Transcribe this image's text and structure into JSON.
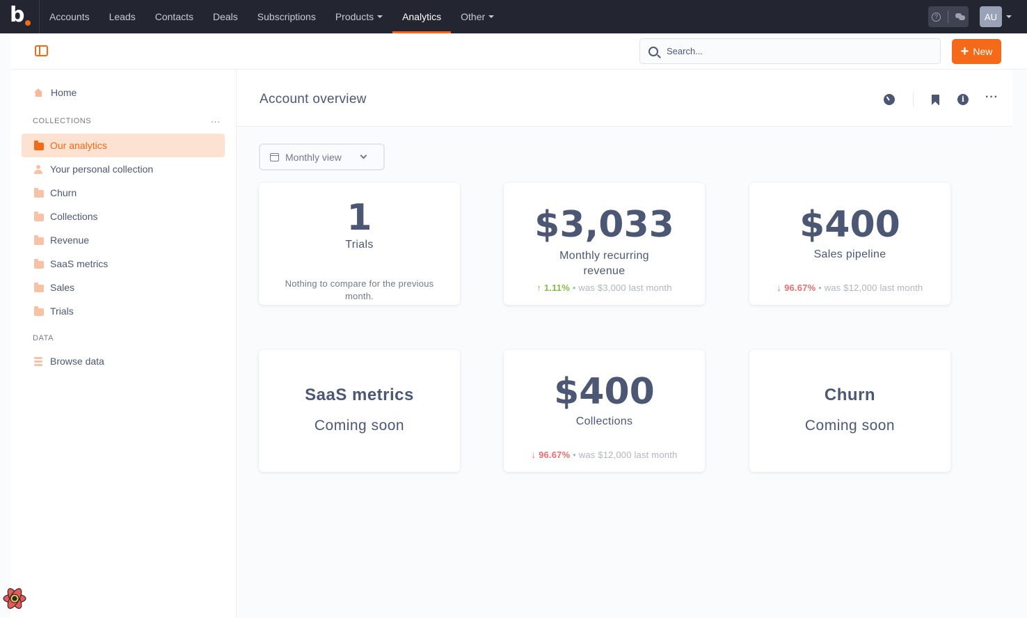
{
  "brand": {
    "logo_letter": "b",
    "accent_color": "#f56a18",
    "nav_bg": "#232530"
  },
  "nav": {
    "items": [
      {
        "label": "Accounts"
      },
      {
        "label": "Leads"
      },
      {
        "label": "Contacts"
      },
      {
        "label": "Deals"
      },
      {
        "label": "Subscriptions"
      },
      {
        "label": "Products",
        "dropdown": true
      },
      {
        "label": "Analytics",
        "active": true
      },
      {
        "label": "Other",
        "dropdown": true
      }
    ],
    "user_initials": "AU"
  },
  "toolbar": {
    "search_placeholder": "Search...",
    "new_label": "New"
  },
  "sidebar": {
    "home_label": "Home",
    "collections_heading": "COLLECTIONS",
    "collections_more": "...",
    "collections": [
      {
        "label": "Our analytics",
        "icon": "folder-icon",
        "active": true
      },
      {
        "label": "Your personal collection",
        "icon": "person-icon"
      },
      {
        "label": "Churn",
        "icon": "folder-icon"
      },
      {
        "label": "Collections",
        "icon": "folder-icon"
      },
      {
        "label": "Revenue",
        "icon": "folder-icon"
      },
      {
        "label": "SaaS metrics",
        "icon": "folder-icon"
      },
      {
        "label": "Sales",
        "icon": "folder-icon"
      },
      {
        "label": "Trials",
        "icon": "folder-icon"
      }
    ],
    "data_heading": "DATA",
    "browse_label": "Browse data"
  },
  "page": {
    "title": "Account overview",
    "filter_label": "Monthly view"
  },
  "cards": {
    "trials": {
      "value": "1",
      "label": "Trials",
      "note": "Nothing to compare for the previous month."
    },
    "mrr": {
      "value": "$3,033",
      "label_line1": "Monthly recurring",
      "label_line2": "revenue",
      "delta": "1.11%",
      "direction": "up",
      "previous": "• was $3,000 last month"
    },
    "pipeline": {
      "value": "$400",
      "label": "Sales pipeline",
      "delta": "96.67%",
      "direction": "down",
      "previous": "• was $12,000 last month"
    },
    "saas": {
      "title": "SaaS metrics",
      "subtitle": "Coming soon"
    },
    "collections": {
      "value": "$400",
      "label": "Collections",
      "delta": "96.67%",
      "direction": "down",
      "previous": "• was $12,000 last month"
    },
    "churn": {
      "title": "Churn",
      "subtitle": "Coming soon"
    }
  }
}
